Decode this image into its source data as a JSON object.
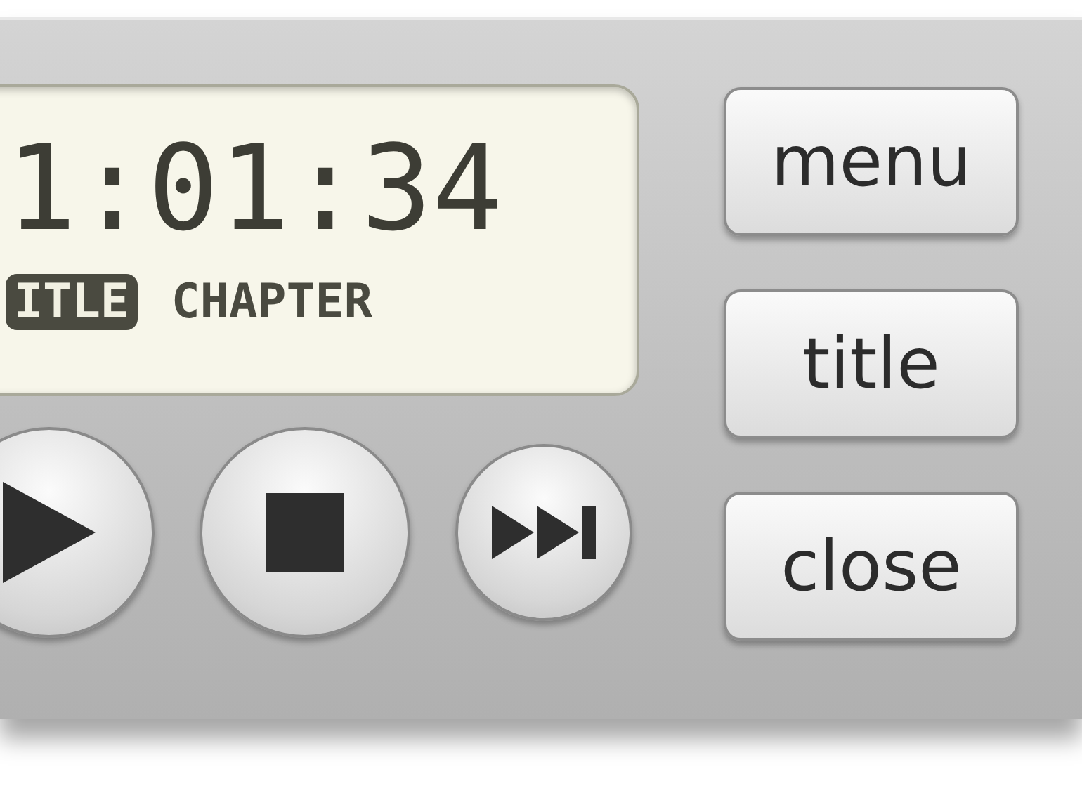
{
  "display": {
    "time": "1:01:34",
    "modes": [
      {
        "label": "ITLE",
        "selected": true
      },
      {
        "label": "CHAPTER",
        "selected": false
      }
    ]
  },
  "transport": [
    {
      "kind": "play"
    },
    {
      "kind": "stop"
    },
    {
      "kind": "next"
    }
  ],
  "buttons": [
    "menu",
    "title",
    "close"
  ]
}
